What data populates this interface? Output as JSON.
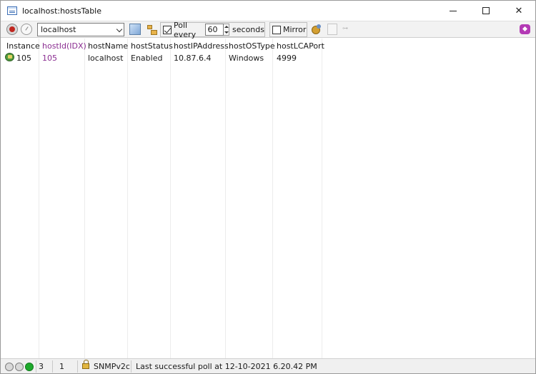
{
  "window": {
    "title": "localhost:hostsTable",
    "minimize_glyph": "—",
    "maximize_glyph": "☐",
    "close_glyph": "✕"
  },
  "toolbar": {
    "agent_value": "localhost",
    "poll_checked": true,
    "poll_label": "Poll every",
    "poll_interval": "60",
    "seconds_label": "seconds",
    "mirror_checked": false,
    "mirror_label": "Mirror",
    "compare_glyph": "⊶"
  },
  "table": {
    "columns": [
      "Instance",
      "hostId(IDX)",
      "hostName",
      "hostStatus",
      "hostIPAddress",
      "hostOSType",
      "hostLCAPort"
    ],
    "rows": [
      [
        "105",
        "105",
        "localhost",
        "Enabled",
        "10.87.6.4",
        "Windows",
        "4999"
      ]
    ]
  },
  "statusbar": {
    "count_a": "3",
    "count_b": "1",
    "snmp_version": "SNMPv2c",
    "message": "Last successful poll at 12-10-2021 6.20.42 PM"
  },
  "colors": {
    "index_column": "#8a2d91",
    "status_green": "#1eaa2c",
    "stop_red": "#c0261f"
  }
}
